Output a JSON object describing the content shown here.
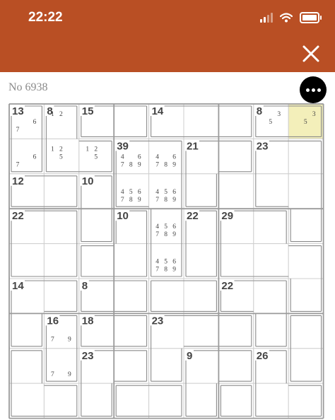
{
  "status_bar": {
    "time": "22:22"
  },
  "header": {
    "close_icon": "close-icon",
    "background": "#b94f24"
  },
  "puzzle": {
    "number_label": "No 6938",
    "more_icon": "more-options-icon",
    "selected_cell": [
      0,
      8
    ],
    "selected_color": "#f3efba",
    "cage_sums": [
      {
        "cell": [
          0,
          0
        ],
        "sum": "13"
      },
      {
        "cell": [
          0,
          1
        ],
        "sum": "8"
      },
      {
        "cell": [
          0,
          2
        ],
        "sum": "15"
      },
      {
        "cell": [
          0,
          4
        ],
        "sum": "14"
      },
      {
        "cell": [
          0,
          7
        ],
        "sum": "8"
      },
      {
        "cell": [
          1,
          3
        ],
        "sum": "39"
      },
      {
        "cell": [
          1,
          5
        ],
        "sum": "21"
      },
      {
        "cell": [
          1,
          7
        ],
        "sum": "23"
      },
      {
        "cell": [
          2,
          0
        ],
        "sum": "12"
      },
      {
        "cell": [
          2,
          2
        ],
        "sum": "10"
      },
      {
        "cell": [
          3,
          0
        ],
        "sum": "22"
      },
      {
        "cell": [
          3,
          3
        ],
        "sum": "10"
      },
      {
        "cell": [
          3,
          5
        ],
        "sum": "22"
      },
      {
        "cell": [
          3,
          6
        ],
        "sum": "29"
      },
      {
        "cell": [
          5,
          0
        ],
        "sum": "14"
      },
      {
        "cell": [
          5,
          2
        ],
        "sum": "8"
      },
      {
        "cell": [
          5,
          6
        ],
        "sum": "22"
      },
      {
        "cell": [
          6,
          1
        ],
        "sum": "16"
      },
      {
        "cell": [
          6,
          2
        ],
        "sum": "18"
      },
      {
        "cell": [
          6,
          4
        ],
        "sum": "23"
      },
      {
        "cell": [
          7,
          2
        ],
        "sum": "23"
      },
      {
        "cell": [
          7,
          5
        ],
        "sum": "9"
      },
      {
        "cell": [
          7,
          7
        ],
        "sum": "26"
      }
    ],
    "candidates": [
      {
        "cell": [
          0,
          0
        ],
        "digits": "67"
      },
      {
        "cell": [
          1,
          0
        ],
        "digits": "67"
      },
      {
        "cell": [
          0,
          1
        ],
        "digits": "12"
      },
      {
        "cell": [
          1,
          1
        ],
        "digits": "125"
      },
      {
        "cell": [
          1,
          2
        ],
        "digits": "125"
      },
      {
        "cell": [
          0,
          7
        ],
        "digits": "35"
      },
      {
        "cell": [
          0,
          8
        ],
        "digits": "35"
      },
      {
        "cell": [
          1,
          3
        ],
        "digits": "46789"
      },
      {
        "cell": [
          1,
          4
        ],
        "digits": "46789"
      },
      {
        "cell": [
          2,
          3
        ],
        "digits": "456789"
      },
      {
        "cell": [
          2,
          4
        ],
        "digits": "456789"
      },
      {
        "cell": [
          3,
          4
        ],
        "digits": "456789"
      },
      {
        "cell": [
          4,
          4
        ],
        "digits": "456789"
      },
      {
        "cell": [
          6,
          1
        ],
        "digits": "79"
      },
      {
        "cell": [
          7,
          1
        ],
        "digits": "79"
      }
    ],
    "cages": [
      [
        [
          0,
          0
        ],
        [
          1,
          0
        ]
      ],
      [
        [
          0,
          1
        ],
        [
          1,
          1
        ],
        [
          1,
          2
        ]
      ],
      [
        [
          0,
          2
        ],
        [
          0,
          3
        ]
      ],
      [
        [
          0,
          4
        ],
        [
          0,
          5
        ],
        [
          0,
          6
        ]
      ],
      [
        [
          0,
          7
        ],
        [
          0,
          8
        ]
      ],
      [
        [
          1,
          3
        ],
        [
          1,
          4
        ],
        [
          2,
          3
        ],
        [
          2,
          4
        ],
        [
          3,
          4
        ],
        [
          4,
          4
        ]
      ],
      [
        [
          1,
          5
        ],
        [
          1,
          6
        ],
        [
          2,
          5
        ]
      ],
      [
        [
          1,
          7
        ],
        [
          1,
          8
        ],
        [
          2,
          7
        ],
        [
          2,
          8
        ],
        [
          3,
          8
        ]
      ],
      [
        [
          2,
          0
        ],
        [
          2,
          1
        ]
      ],
      [
        [
          2,
          2
        ],
        [
          3,
          2
        ]
      ],
      [
        [
          3,
          0
        ],
        [
          3,
          1
        ],
        [
          4,
          0
        ],
        [
          4,
          1
        ]
      ],
      [
        [
          3,
          3
        ],
        [
          4,
          3
        ],
        [
          4,
          2
        ]
      ],
      [
        [
          3,
          5
        ],
        [
          4,
          5
        ]
      ],
      [
        [
          3,
          6
        ],
        [
          3,
          7
        ],
        [
          4,
          6
        ],
        [
          4,
          7
        ],
        [
          4,
          8
        ],
        [
          5,
          8
        ]
      ],
      [
        [
          5,
          0
        ],
        [
          5,
          1
        ],
        [
          6,
          0
        ]
      ],
      [
        [
          5,
          2
        ],
        [
          5,
          3
        ]
      ],
      [
        [
          5,
          4
        ],
        [
          5,
          5
        ]
      ],
      [
        [
          5,
          6
        ],
        [
          5,
          7
        ],
        [
          6,
          7
        ]
      ],
      [
        [
          6,
          1
        ],
        [
          7,
          1
        ]
      ],
      [
        [
          6,
          2
        ],
        [
          6,
          3
        ]
      ],
      [
        [
          6,
          4
        ],
        [
          6,
          5
        ],
        [
          6,
          6
        ],
        [
          7,
          4
        ]
      ],
      [
        [
          6,
          8
        ],
        [
          7,
          8
        ]
      ],
      [
        [
          7,
          0
        ],
        [
          8,
          0
        ],
        [
          8,
          1
        ]
      ],
      [
        [
          7,
          2
        ],
        [
          7,
          3
        ],
        [
          8,
          2
        ]
      ],
      [
        [
          7,
          5
        ],
        [
          7,
          6
        ],
        [
          8,
          5
        ]
      ],
      [
        [
          7,
          7
        ],
        [
          8,
          7
        ],
        [
          8,
          8
        ]
      ],
      [
        [
          8,
          3
        ],
        [
          8,
          4
        ]
      ],
      [
        [
          8,
          6
        ]
      ]
    ]
  }
}
